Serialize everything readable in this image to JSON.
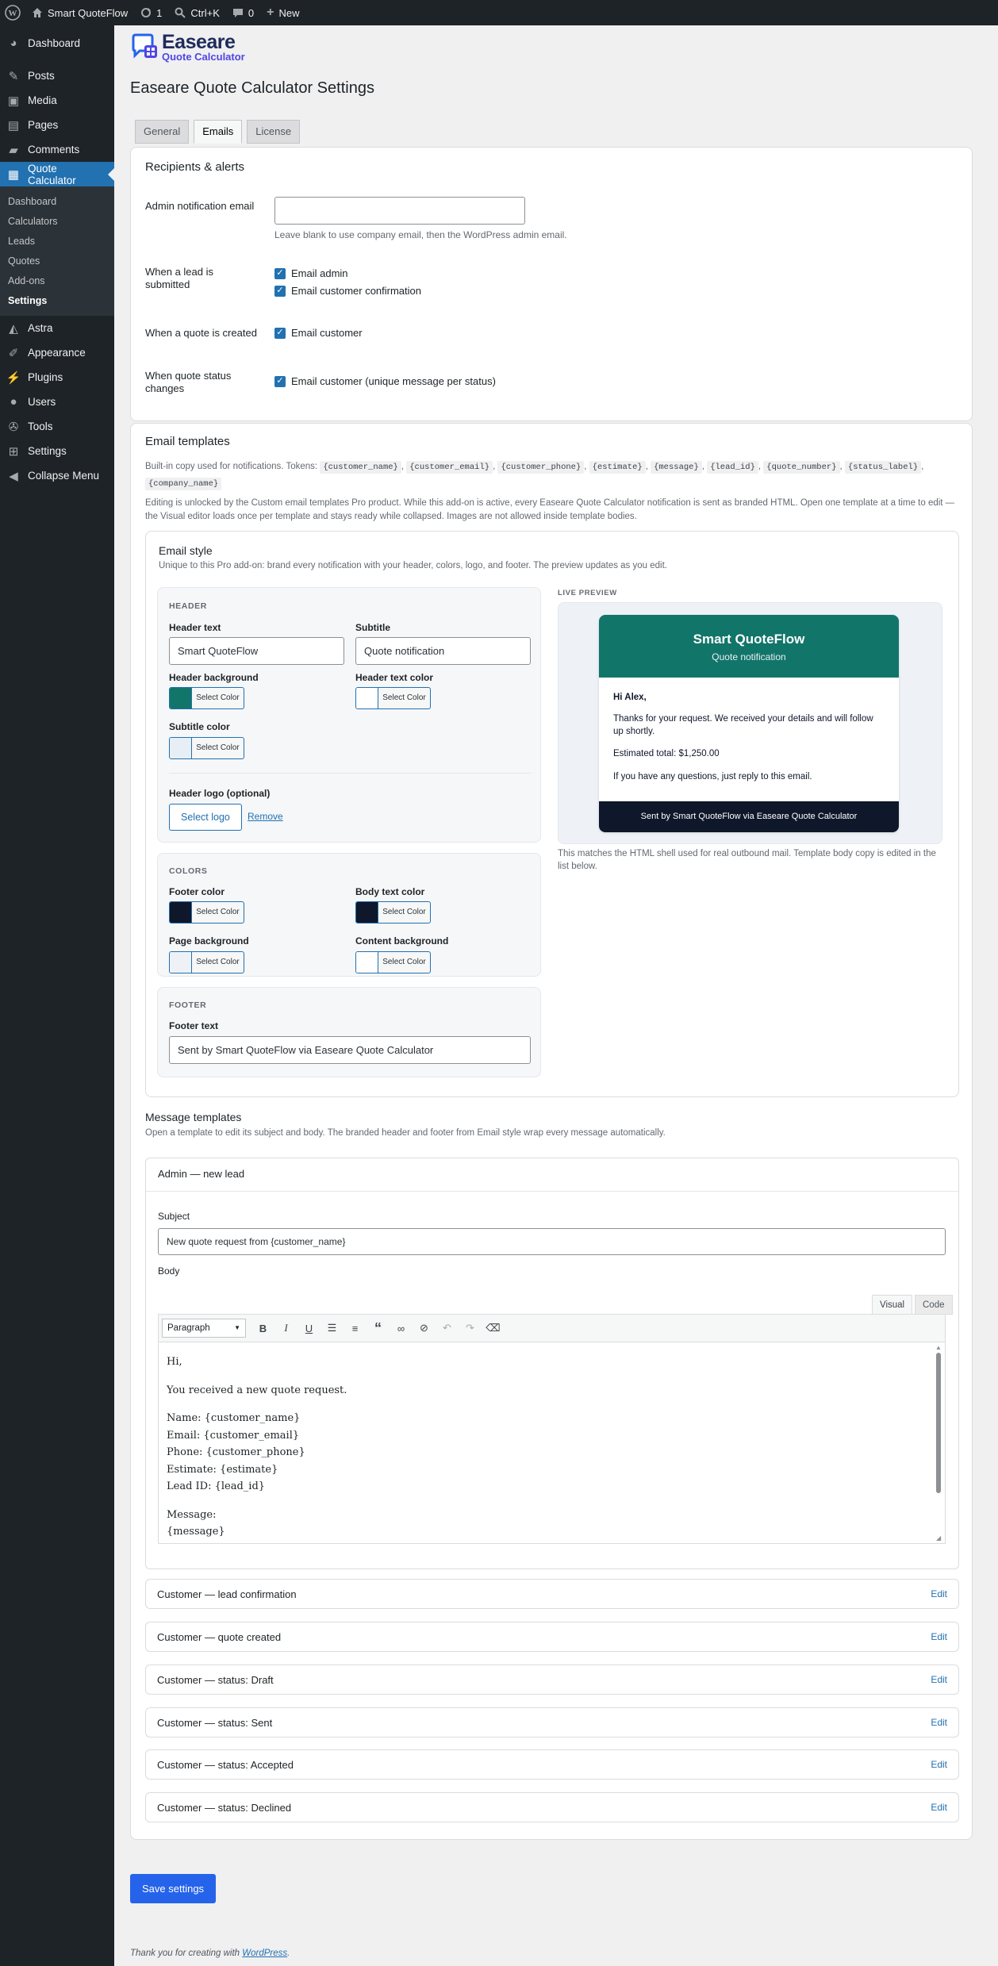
{
  "adminbar": {
    "site_name": "Smart QuoteFlow",
    "updates_count": "1",
    "search_shortcut": "Ctrl+K",
    "comments_count": "0",
    "new_label": "New"
  },
  "sidebar": {
    "items_top": [
      {
        "label": "Dashboard",
        "icon": "dashboard-icon"
      },
      {
        "label": "Posts",
        "icon": "pin-icon"
      },
      {
        "label": "Media",
        "icon": "media-icon"
      },
      {
        "label": "Pages",
        "icon": "pages-icon"
      },
      {
        "label": "Comments",
        "icon": "comment-icon"
      },
      {
        "label": "Quote Calculator",
        "icon": "calculator-icon"
      }
    ],
    "submenu": [
      "Dashboard",
      "Calculators",
      "Leads",
      "Quotes",
      "Add-ons",
      "Settings"
    ],
    "items_bottom": [
      {
        "label": "Astra",
        "icon": "astra-icon"
      },
      {
        "label": "Appearance",
        "icon": "brush-icon"
      },
      {
        "label": "Plugins",
        "icon": "plug-icon"
      },
      {
        "label": "Users",
        "icon": "user-icon"
      },
      {
        "label": "Tools",
        "icon": "wrench-icon"
      },
      {
        "label": "Settings",
        "icon": "settings-icon"
      },
      {
        "label": "Collapse Menu",
        "icon": "collapse-icon"
      }
    ]
  },
  "logo": {
    "line1": "Easeare",
    "line2": "Quote Calculator"
  },
  "page_title": "Easeare Quote Calculator Settings",
  "tabs": [
    "General",
    "Emails",
    "License"
  ],
  "recipients": {
    "title": "Recipients & alerts",
    "admin_email_label": "Admin notification email",
    "admin_email_value": "",
    "admin_email_help": "Leave blank to use company email, then the WordPress admin email.",
    "lead_submitted_label": "When a lead is submitted",
    "lead_opt1": "Email admin",
    "lead_opt2": "Email customer confirmation",
    "quote_created_label": "When a quote is created",
    "quote_opt": "Email customer",
    "status_changes_label": "When quote status changes",
    "status_opt": "Email customer (unique message per status)"
  },
  "templates": {
    "title": "Email templates",
    "tokens_intro": "Built-in copy used for notifications. Tokens:",
    "tokens": [
      "{customer_name}",
      "{customer_email}",
      "{customer_phone}",
      "{estimate}",
      "{message}",
      "{lead_id}",
      "{quote_number}",
      "{status_label}",
      "{company_name}"
    ],
    "unlock_note": "Editing is unlocked by the Custom email templates Pro product. While this add-on is active, every Easeare Quote Calculator notification is sent as branded HTML. Open one template at a time to edit — the Visual editor loads once per template and stays ready while collapsed. Images are not allowed inside template bodies."
  },
  "email_style": {
    "title": "Email style",
    "desc": "Unique to this Pro add-on: brand every notification with your header, colors, logo, and footer. The preview updates as you edit.",
    "header_cap": "HEADER",
    "header_text_label": "Header text",
    "header_text_value": "Smart QuoteFlow",
    "subtitle_label": "Subtitle",
    "subtitle_value": "Quote notification",
    "header_bg_label": "Header background",
    "header_text_color_label": "Header text color",
    "subtitle_color_label": "Subtitle color",
    "select_color": "Select Color",
    "logo_label": "Header logo (optional)",
    "select_logo": "Select logo",
    "remove": "Remove",
    "colors_cap": "COLORS",
    "footer_color_label": "Footer color",
    "body_text_color_label": "Body text color",
    "page_bg_label": "Page background",
    "content_bg_label": "Content background",
    "footer_cap": "FOOTER",
    "footer_text_label": "Footer text",
    "footer_text_value": "Sent by Smart QuoteFlow via Easeare Quote Calculator",
    "colors": {
      "header_bg": "#127569",
      "header_text": "#ffffff",
      "subtitle": "#e8eef5",
      "footer": "#0f172a",
      "body_text": "#0f172a",
      "page_bg": "#eef2f7",
      "content_bg": "#ffffff"
    }
  },
  "preview": {
    "cap": "LIVE PREVIEW",
    "header": "Smart QuoteFlow",
    "subtitle": "Quote notification",
    "greeting": "Hi Alex,",
    "p1": "Thanks for your request. We received your details and will follow up shortly.",
    "p2": "Estimated total: $1,250.00",
    "p3": "If you have any questions, just reply to this email.",
    "footer": "Sent by Smart QuoteFlow via Easeare Quote Calculator",
    "note": "This matches the HTML shell used for real outbound mail. Template body copy is edited in the list below."
  },
  "message_templates": {
    "title": "Message templates",
    "desc": "Open a template to edit its subject and body. The branded header and footer from Email style wrap every message automatically.",
    "open_title": "Admin — new lead",
    "subject_label": "Subject",
    "subject_value": "New quote request from {customer_name}",
    "body_label": "Body",
    "tab_visual": "Visual",
    "tab_code": "Code",
    "format_select": "Paragraph",
    "body_lines": {
      "l1": "Hi,",
      "l2": "You received a new quote request.",
      "l3": "Name: {customer_name}",
      "l4": "Email: {customer_email}",
      "l5": "Phone: {customer_phone}",
      "l6": "Estimate: {estimate}",
      "l7": "Lead ID: {lead_id}",
      "l8": "Message:",
      "l9": "{message}"
    },
    "collapsed": [
      "Customer — lead confirmation",
      "Customer — quote created",
      "Customer — status: Draft",
      "Customer — status: Sent",
      "Customer — status: Accepted",
      "Customer — status: Declined"
    ],
    "edit_label": "Edit"
  },
  "save_button": "Save settings",
  "footer": {
    "thanks": "Thank you for creating with",
    "wp_link": "WordPress",
    "period": "."
  }
}
